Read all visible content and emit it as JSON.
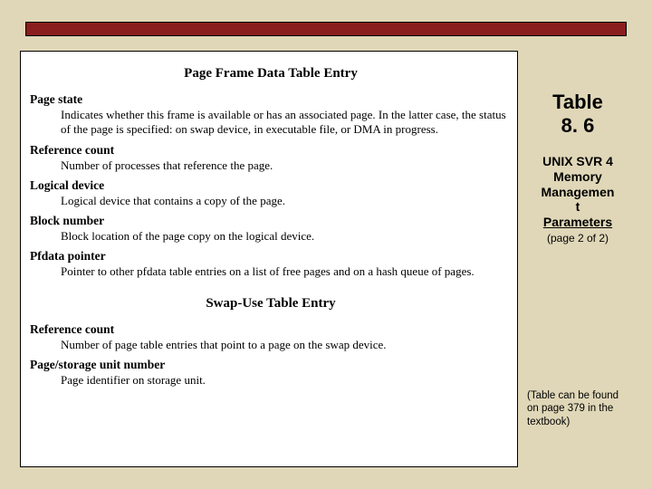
{
  "table": {
    "section1_title": "Page Frame Data Table Entry",
    "entries1": [
      {
        "term": "Page state",
        "def": "Indicates whether this frame is available or has an associated page. In the latter case, the status of the page is specified: on swap device, in executable file, or DMA in progress."
      },
      {
        "term": "Reference count",
        "def": "Number of processes that reference the page."
      },
      {
        "term": "Logical device",
        "def": "Logical device that contains a copy of the page."
      },
      {
        "term": "Block number",
        "def": "Block location of the page copy on the logical device."
      },
      {
        "term": "Pfdata pointer",
        "def": "Pointer to other pfdata table entries on a list of free pages and on a hash queue of pages."
      }
    ],
    "section2_title": "Swap-Use Table Entry",
    "entries2": [
      {
        "term": "Reference count",
        "def": "Number of page table entries that point to a page on the swap device."
      },
      {
        "term": "Page/storage unit number",
        "def": "Page identifier on storage unit."
      }
    ]
  },
  "side": {
    "title_l1": "Table",
    "title_l2": "8. 6",
    "sub_l1": "UNIX SVR 4",
    "sub_l2": "Memory",
    "sub_l3": "Managemen",
    "sub_l4": "t",
    "sub_l5": "Parameters",
    "page_note": "(page 2 of 2)",
    "foot": "(Table can be found on page 379 in the textbook)"
  }
}
